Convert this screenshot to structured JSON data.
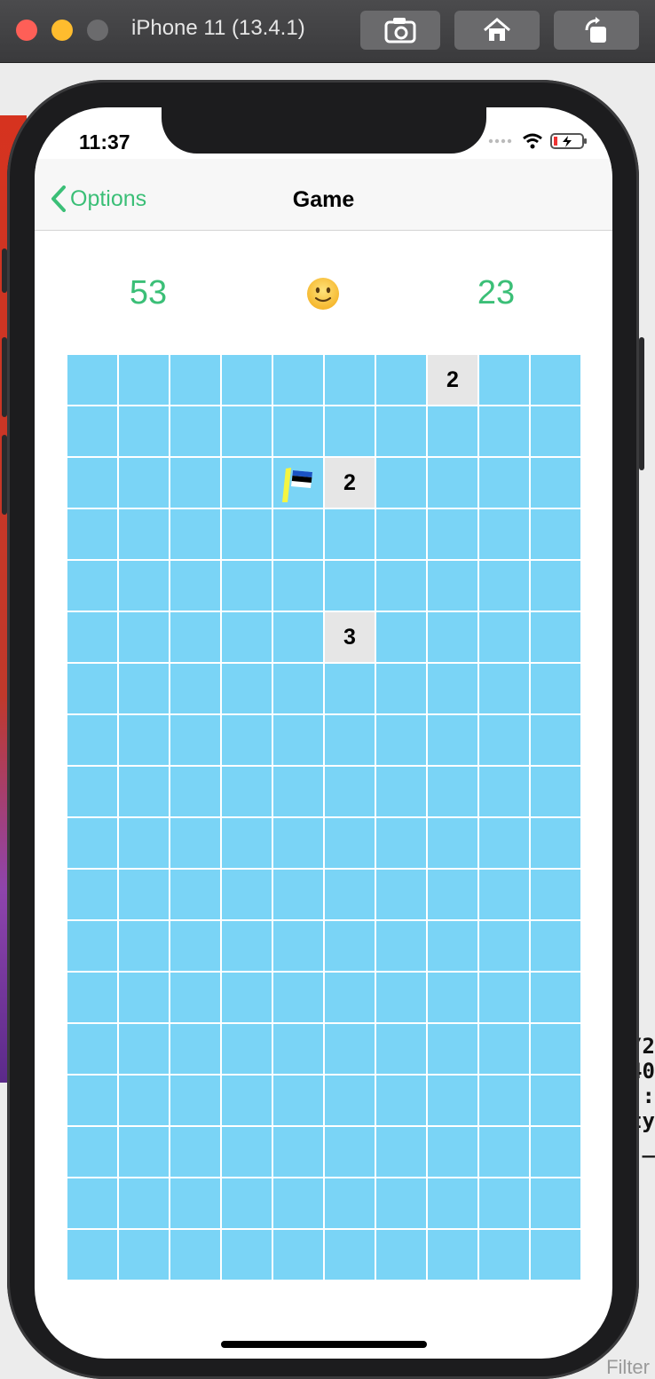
{
  "simulator": {
    "title": "iPhone 11 (13.4.1)",
    "buttons": [
      "screenshot-icon",
      "home-icon",
      "rotate-icon"
    ]
  },
  "status_bar": {
    "time": "11:37"
  },
  "nav": {
    "back_label": "Options",
    "title": "Game"
  },
  "game": {
    "mines_remaining": "53",
    "timer": "23",
    "face": "slightly-smiling-face-icon",
    "columns": 10,
    "rows": 18,
    "cells": [
      {
        "row": 0,
        "col": 7,
        "state": "revealed",
        "label": "2"
      },
      {
        "row": 2,
        "col": 4,
        "state": "flag",
        "label": ""
      },
      {
        "row": 2,
        "col": 5,
        "state": "revealed",
        "label": "2"
      },
      {
        "row": 5,
        "col": 5,
        "state": "revealed",
        "label": "3"
      }
    ]
  },
  "colors": {
    "accent": "#3bbf77",
    "hidden_cell": "#7ad4f6",
    "revealed_cell": "#e6e6e6"
  },
  "background_text": [
    "/2",
    "40",
    ":",
    "ty",
    "_"
  ],
  "background_filter": "Filter"
}
